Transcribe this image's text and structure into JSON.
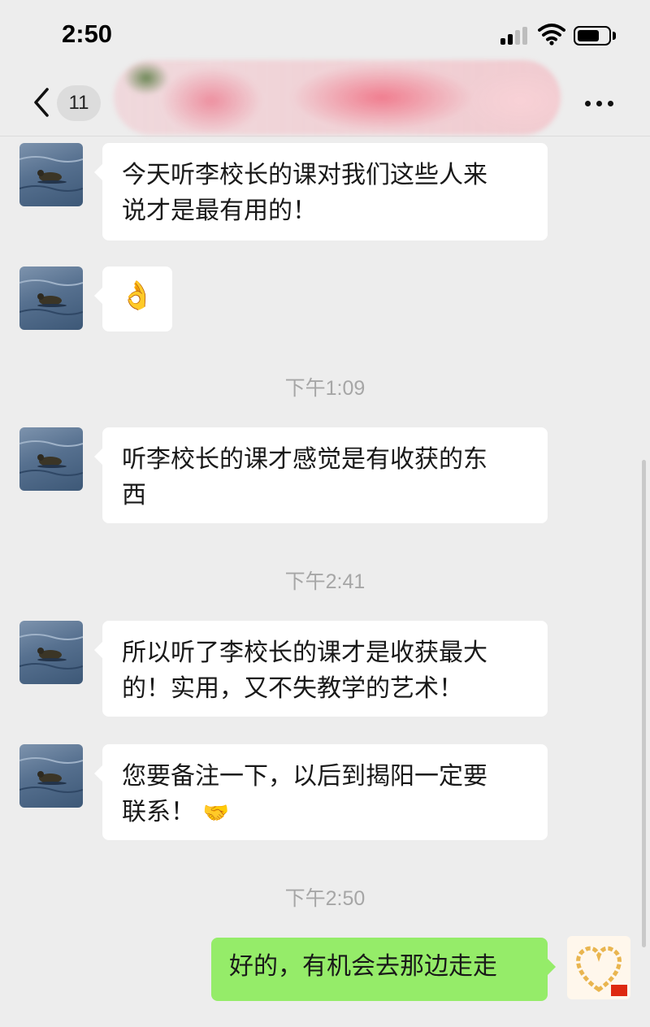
{
  "status_bar": {
    "time": "2:50"
  },
  "nav": {
    "unread_count": "11",
    "contact_name": ""
  },
  "messages": [
    {
      "sender": "contact",
      "text_lines": [
        "今天听李校长的课对我们这些人来",
        "说才是最有用的！"
      ]
    },
    {
      "sender": "contact",
      "emoji": "👌",
      "emoji_name": "ok-hand"
    },
    {
      "timestamp": "下午1:09"
    },
    {
      "sender": "contact",
      "text_lines": [
        "听李校长的课才感觉是有收获的东",
        "西"
      ]
    },
    {
      "timestamp": "下午2:41"
    },
    {
      "sender": "contact",
      "text_lines": [
        "所以听了李校长的课才是收获最大",
        "的！实用，又不失教学的艺术！"
      ]
    },
    {
      "sender": "contact",
      "text_lines": [
        "您要备注一下，以后到揭阳一定要",
        "联系！"
      ],
      "trailing_emoji": "🤝",
      "trailing_emoji_name": "handshake"
    },
    {
      "timestamp": "下午2:50"
    },
    {
      "sender": "me",
      "text_lines": [
        "好的，有机会去那边走走"
      ]
    }
  ],
  "colors": {
    "background": "#ededed",
    "incoming_bubble": "#ffffff",
    "outgoing_bubble": "#95ec69",
    "timestamp_text": "#a6a6a6"
  }
}
